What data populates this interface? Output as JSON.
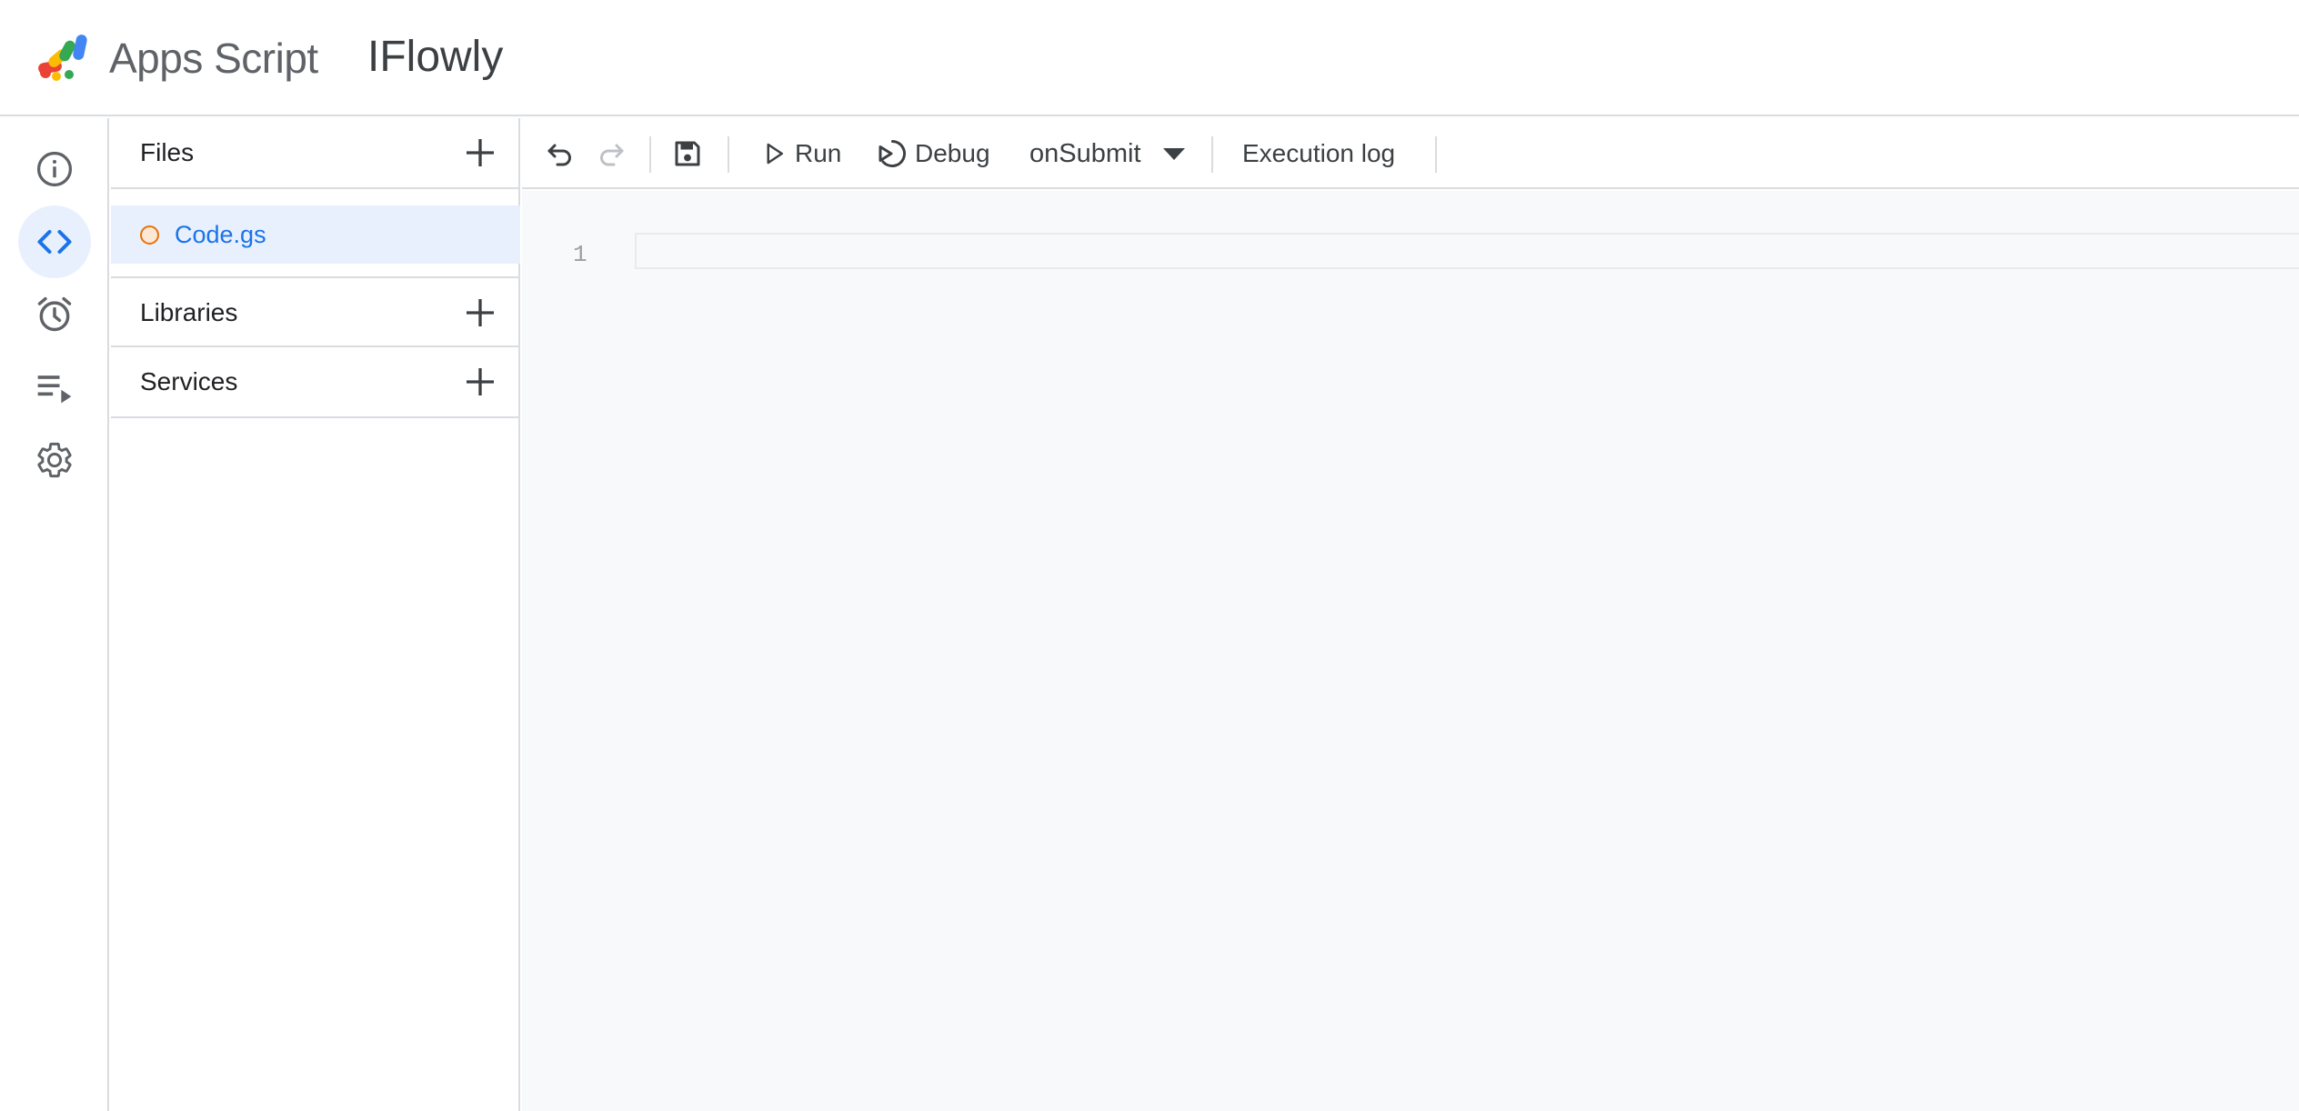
{
  "header": {
    "brand": "Apps Script",
    "project_title": "IFlowly",
    "logo_icon": "apps-script-logo"
  },
  "rail": {
    "items": [
      {
        "name": "overview",
        "icon": "info-icon",
        "active": false
      },
      {
        "name": "editor",
        "icon": "code-icon",
        "active": true
      },
      {
        "name": "triggers",
        "icon": "alarm-clock-icon",
        "active": false
      },
      {
        "name": "executions",
        "icon": "playlist-play-icon",
        "active": false
      },
      {
        "name": "project-settings",
        "icon": "gear-icon",
        "active": false
      }
    ]
  },
  "files_panel": {
    "files_title": "Files",
    "libraries_title": "Libraries",
    "services_title": "Services",
    "files": [
      {
        "name": "Code.gs",
        "status_color": "#e8710a",
        "selected": true
      }
    ]
  },
  "toolbar": {
    "undo_icon": "undo-icon",
    "redo_icon": "redo-icon",
    "save_icon": "save-icon",
    "run_label": "Run",
    "debug_label": "Debug",
    "function_name": "onSubmit",
    "execution_log_label": "Execution log"
  },
  "editor": {
    "line_numbers": [
      "1"
    ]
  },
  "colors": {
    "accent": "#1a73e8",
    "active_bg": "#e8f0fe",
    "divider": "#dadce0",
    "editor_bg": "#f8f9fa"
  }
}
